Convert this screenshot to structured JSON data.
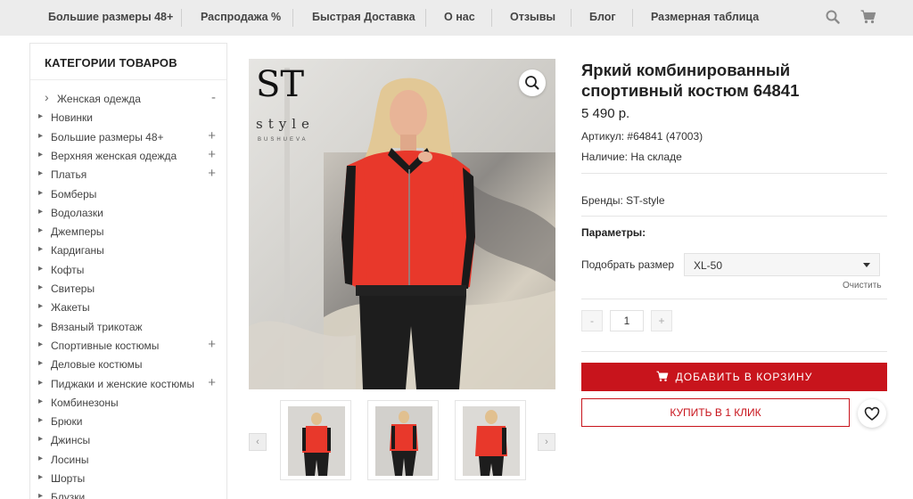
{
  "nav": {
    "items": [
      {
        "label": "Большие размеры 48+"
      },
      {
        "label": "Распродажа %"
      },
      {
        "label": "Быстрая Доставка"
      },
      {
        "label": "О нас"
      },
      {
        "label": "Отзывы"
      },
      {
        "label": "Блог"
      },
      {
        "label": "Размерная таблица"
      }
    ],
    "search_icon": "search-icon",
    "cart_icon": "cart-icon"
  },
  "sidebar": {
    "title": "КАТЕГОРИИ ТОВАРОВ",
    "items": [
      {
        "label": "Женская одежда",
        "toggle": "-"
      },
      {
        "label": "Новинки",
        "toggle": ""
      },
      {
        "label": "Большие размеры 48+",
        "toggle": "+"
      },
      {
        "label": "Верхняя женская одежда",
        "toggle": "+"
      },
      {
        "label": "Платья",
        "toggle": "+"
      },
      {
        "label": "Бомберы",
        "toggle": ""
      },
      {
        "label": "Водолазки",
        "toggle": ""
      },
      {
        "label": "Джемперы",
        "toggle": ""
      },
      {
        "label": "Кардиганы",
        "toggle": ""
      },
      {
        "label": "Кофты",
        "toggle": ""
      },
      {
        "label": "Свитеры",
        "toggle": ""
      },
      {
        "label": "Жакеты",
        "toggle": ""
      },
      {
        "label": "Вязаный трикотаж",
        "toggle": ""
      },
      {
        "label": "Спортивные костюмы",
        "toggle": "+"
      },
      {
        "label": "Деловые костюмы",
        "toggle": ""
      },
      {
        "label": "Пиджаки и женские костюмы",
        "toggle": "+"
      },
      {
        "label": "Комбинезоны",
        "toggle": ""
      },
      {
        "label": "Брюки",
        "toggle": ""
      },
      {
        "label": "Джинсы",
        "toggle": ""
      },
      {
        "label": "Лосины",
        "toggle": ""
      },
      {
        "label": "Шорты",
        "toggle": ""
      },
      {
        "label": "Блузки",
        "toggle": ""
      }
    ]
  },
  "gallery": {
    "brand_logo_main": "ST",
    "brand_logo_sub": "style",
    "brand_logo_small": "BUSHUEVA",
    "zoom_icon": "magnifier-icon",
    "prev_label": "‹",
    "next_label": "›"
  },
  "product": {
    "title": "Яркий комбинированный спортивный костюм 64841",
    "price": "5 490 р.",
    "sku": "Артикул: #64841 (47003)",
    "availability": "Наличие: На складе",
    "brands": "Бренды: ST-style",
    "params_heading": "Параметры:",
    "size_label": "Подобрать размер",
    "size_value": "XL-50",
    "clear_label": "Очистить",
    "qty_minus": "-",
    "qty_value": "1",
    "qty_plus": "+",
    "add_to_cart": "ДОБАВИТЬ В КОРЗИНУ",
    "buy_one_click": "КУПИТЬ В 1 КЛИК",
    "wishlist_icon": "heart-icon"
  },
  "colors": {
    "accent": "#c8141c",
    "nav_bg": "#ececec",
    "jacket": "#e8382b"
  }
}
